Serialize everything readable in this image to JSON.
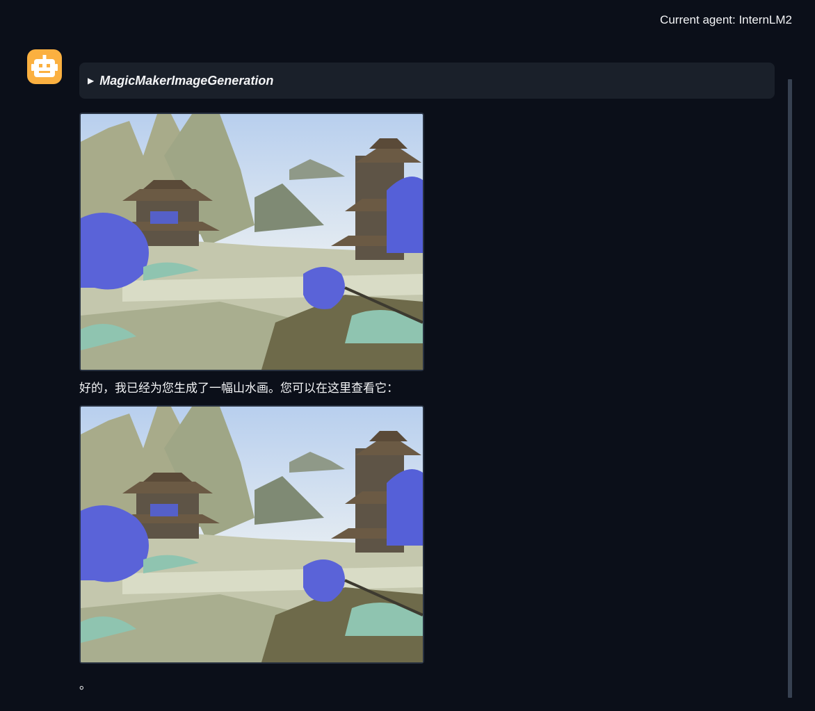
{
  "header": {
    "agent_label": "Current agent: InternLM2"
  },
  "avatar": {
    "icon": "robot-icon",
    "color": "#fbb040"
  },
  "message": {
    "tool_call": {
      "expander_icon": "triangle-right-icon",
      "name": "MagicMakerImageGeneration"
    },
    "images": [
      {
        "description_icon": "landscape-painting"
      },
      {
        "description_icon": "landscape-painting"
      }
    ],
    "text": "好的，我已经为您生成了一幅山水画。您可以在这里查看它：",
    "trailing_text": "。"
  },
  "colors": {
    "background": "#0b0f19",
    "card": "#1a202a",
    "scrollbar": "#374151"
  }
}
